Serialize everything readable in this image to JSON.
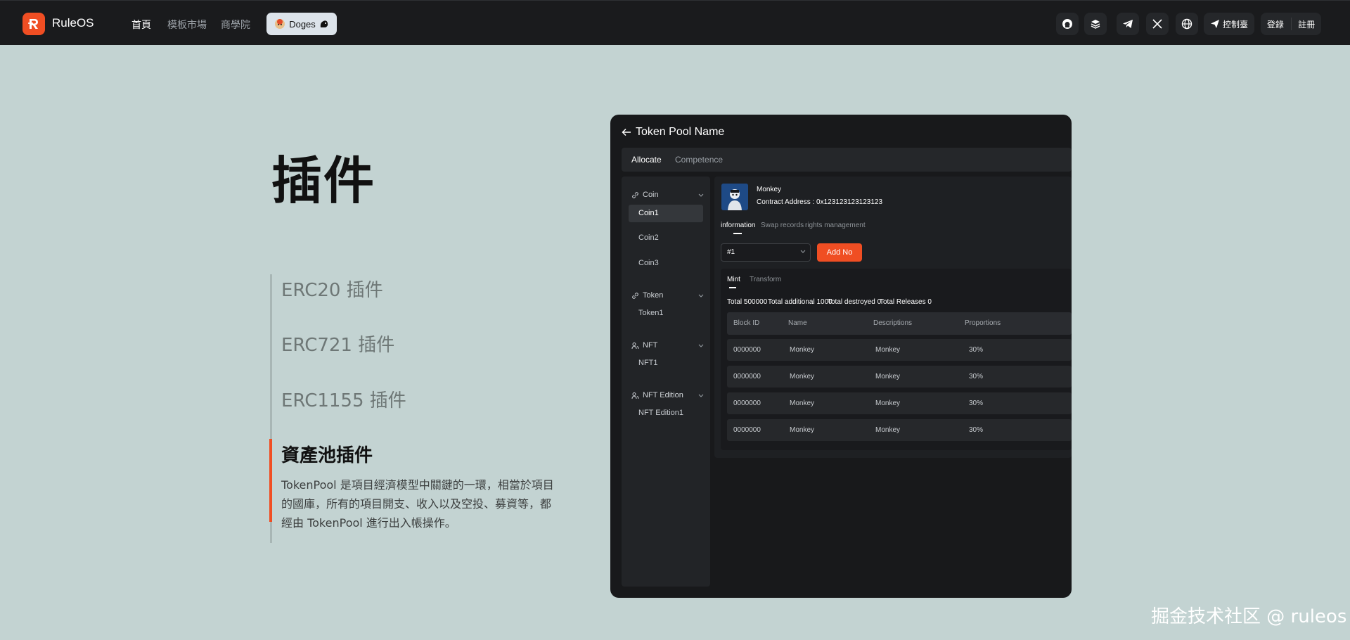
{
  "header": {
    "brand": "RuleOS",
    "nav": [
      "首頁",
      "模板市場",
      "商學院"
    ],
    "doges_label": "Doges",
    "console_label": "控制臺",
    "login_label": "登錄",
    "register_label": "註冊"
  },
  "page": {
    "title": "插件",
    "plugins": [
      "ERC20 插件",
      "ERC721 插件",
      "ERC1155 插件",
      "資產池插件"
    ],
    "active_plugin_index": 3,
    "description": "TokenPool 是項目經濟模型中關鍵的一環，相當於項目的國庫，所有的項目開支、收入以及空投、募資等，都經由 TokenPool 進行出入帳操作。"
  },
  "preview": {
    "title": "Token Pool Name",
    "tabs": [
      "Allocate",
      "Competence"
    ],
    "sidebar": {
      "groups": [
        {
          "label": "Coin",
          "items": [
            "Coin1",
            "Coin2",
            "Coin3"
          ]
        },
        {
          "label": "Token",
          "items": [
            "Token1"
          ]
        },
        {
          "label": "NFT",
          "items": [
            "NFT1"
          ]
        },
        {
          "label": "NFT Edition",
          "items": [
            "NFT Edition1"
          ]
        }
      ]
    },
    "main": {
      "name": "Monkey",
      "contract_address": "Contract Address : 0x123123123123123",
      "sub_tabs": [
        "information",
        "Swap records",
        "rights management"
      ],
      "select_value": "#1",
      "add_button": "Add No",
      "inner_tabs": [
        "Mint",
        "Transform"
      ],
      "stats": [
        "Total 500000",
        "Total additional 1000",
        "Total destroyed 0",
        "Total Releases 0"
      ],
      "table": {
        "headers": [
          "Block ID",
          "Name",
          "Descriptions",
          "Proportions"
        ],
        "rows": [
          [
            "0000000",
            "Monkey",
            "Monkey",
            "30%"
          ],
          [
            "0000000",
            "Monkey",
            "Monkey",
            "30%"
          ],
          [
            "0000000",
            "Monkey",
            "Monkey",
            "30%"
          ],
          [
            "0000000",
            "Monkey",
            "Monkey",
            "30%"
          ]
        ]
      }
    }
  },
  "watermark": "掘金技术社区 @ ruleos",
  "colors": {
    "accent": "#f04e23",
    "background": "#c3d3d2",
    "navbar": "#1a1b1d"
  }
}
